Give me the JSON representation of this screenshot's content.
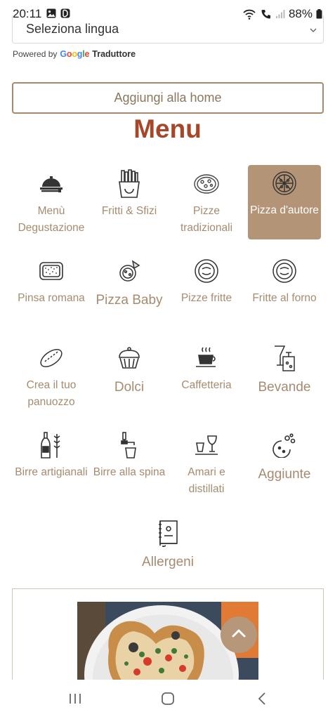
{
  "status": {
    "time": "20:11",
    "battery": "88%"
  },
  "translate": {
    "select_value": "Seleziona lingua",
    "powered_by": "Powered by",
    "google": [
      "G",
      "o",
      "o",
      "g",
      "l",
      "e"
    ],
    "translator": "Traduttore"
  },
  "add_home_label": "Aggiungi alla home",
  "menu_title": "Menu",
  "menu": {
    "items": [
      {
        "label": "Menù Degustazione",
        "icon": "cloche-icon"
      },
      {
        "label": "Fritti & Sfizi",
        "icon": "fries-icon"
      },
      {
        "label": "Pizze tradizionali",
        "icon": "pizza-traditional-icon"
      },
      {
        "label": "Pizza d'autore",
        "icon": "pizza-author-icon",
        "active": true
      },
      {
        "label": "Pinsa romana",
        "icon": "pinsa-icon"
      },
      {
        "label": "Pizza Baby",
        "icon": "pizza-baby-icon"
      },
      {
        "label": "Pizze fritte",
        "icon": "fried-pizza-icon"
      },
      {
        "label": "Fritte al forno",
        "icon": "baked-fried-pizza-icon"
      },
      {
        "label": "Crea il tuo panuozzo",
        "icon": "panuozzo-icon"
      },
      {
        "label": "Dolci",
        "icon": "cupcake-icon"
      },
      {
        "label": "Caffetteria",
        "icon": "coffee-cup-icon"
      },
      {
        "label": "Bevande",
        "icon": "drinks-icon"
      },
      {
        "label": "Birre artigianali",
        "icon": "craft-beer-icon"
      },
      {
        "label": "Birre alla spina",
        "icon": "beer-tap-icon"
      },
      {
        "label": "Amari e distillati",
        "icon": "liquor-glasses-icon"
      },
      {
        "label": "Aggiunte",
        "icon": "toppings-icon"
      },
      {
        "label": "Allergeni",
        "icon": "allergen-book-icon"
      }
    ]
  },
  "colors": {
    "accent": "#a68b70",
    "title": "#a7472a",
    "active_bg": "#b49476"
  }
}
